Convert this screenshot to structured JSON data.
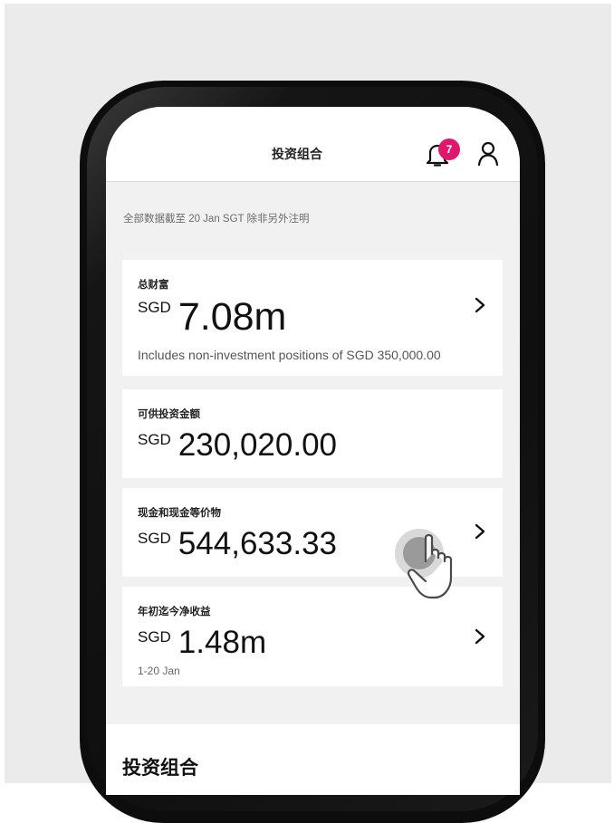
{
  "header": {
    "title": "投资组合",
    "notification_count": "7"
  },
  "as_of": "全部数据截至 20 Jan SGT 除非另外注明",
  "cards": [
    {
      "label": "总财富",
      "currency": "SGD",
      "amount": "7.08m",
      "note": "Includes non-investment positions of SGD 350,000.00"
    },
    {
      "label": "可供投资金额",
      "currency": "SGD",
      "amount": "230,020.00"
    },
    {
      "label": "现金和现金等价物",
      "currency": "SGD",
      "amount": "544,633.33"
    },
    {
      "label": "年初迄今净收益",
      "currency": "SGD",
      "amount": "1.48m",
      "note": "1-20 Jan"
    }
  ],
  "section": {
    "title": "投资组合"
  },
  "colors": {
    "badge": "#e0176d",
    "screen_bg": "#f1f1f1",
    "page_bg": "#ebebeb"
  }
}
